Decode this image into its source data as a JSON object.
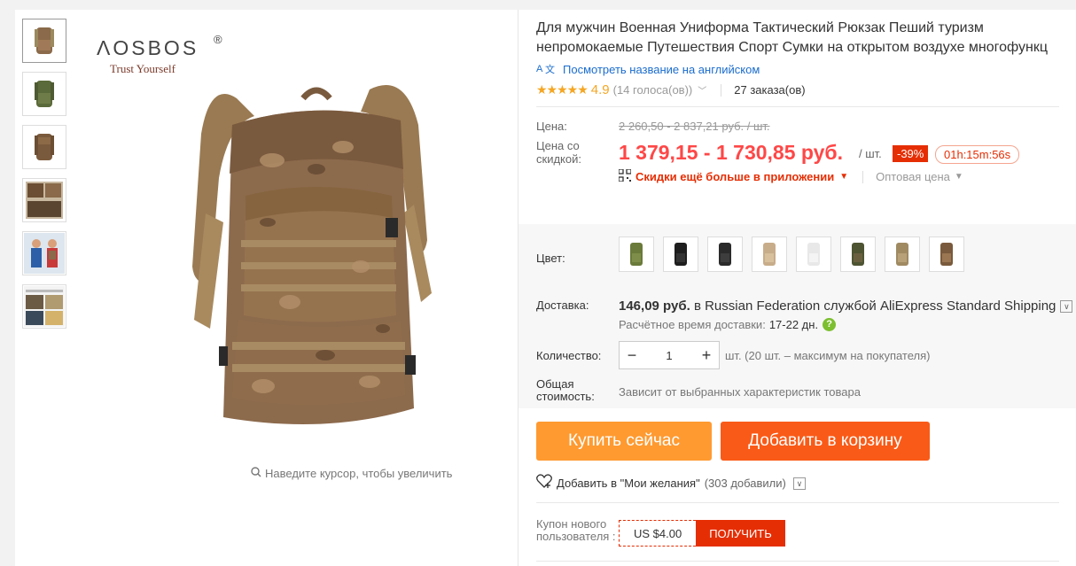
{
  "brand": {
    "name": "ΛOSBOS",
    "reg": "®",
    "tagline": "Trust Yourself"
  },
  "gallery": {
    "zoom_hint": "Наведите курсор, чтобы увеличить"
  },
  "product": {
    "title": "Для мужчин Военная Униформа Тактический Рюкзак Пеший туризм непромокаемые Путешествия Спорт Сумки на открытом воздухе многофункц",
    "translate_label": "Посмотреть название на английском",
    "stars": "★★★★★",
    "rating": "4.9",
    "votes": "(14 голоса(ов))",
    "orders": "27 заказа(ов)"
  },
  "price": {
    "label": "Цена:",
    "old": "2 260,50 - 2 837,21 руб. / шт.",
    "discount_label": "Цена со скидкой:",
    "new": "1 379,15 - 1 730,85 руб.",
    "per_unit": "/ шт.",
    "discount_pct": "-39%",
    "timer": "01h:15m:56s",
    "app_discount": "Скидки ещё больше в приложении",
    "wholesale": "Оптовая цена"
  },
  "props": {
    "color_label": "Цвет:",
    "colors": [
      "python-camo",
      "green",
      "black",
      "black-2",
      "sand",
      "white",
      "woodland",
      "desert-python",
      "brown-python"
    ],
    "shipping_label": "Доставка:",
    "shipping_price": "146,09 руб.",
    "shipping_text": " в Russian Federation службой AliExpress Standard Shipping",
    "eta_label": "Расчётное время доставки:",
    "eta_value": "17-22 дн.",
    "qty_label": "Количество:",
    "qty_value": "1",
    "qty_note": "шт. (20 шт. – максимум на покупателя)",
    "total_label": "Общая стоимость:",
    "total_value": "Зависит от выбранных характеристик товара"
  },
  "actions": {
    "buy_now": "Купить сейчас",
    "add_to_cart": "Добавить в корзину",
    "wishlist": "Добавить в \"Мои желания\"",
    "wishlist_count": "(303 добавили)"
  },
  "coupon": {
    "label": "Купон нового пользователя :",
    "amount": "US $4.00",
    "button": "ПОЛУЧИТЬ"
  },
  "icons": {
    "zoom": "search-icon",
    "translate": "translate-icon",
    "qr": "qr-icon",
    "help": "help-icon",
    "wish": "heart-icon"
  },
  "colors_theme": {
    "accent_red": "#ff4747",
    "buy_orange": "#ff9a30",
    "cart_orange": "#fa5a17",
    "link_blue": "#1a6cce",
    "star": "#f5a623"
  }
}
